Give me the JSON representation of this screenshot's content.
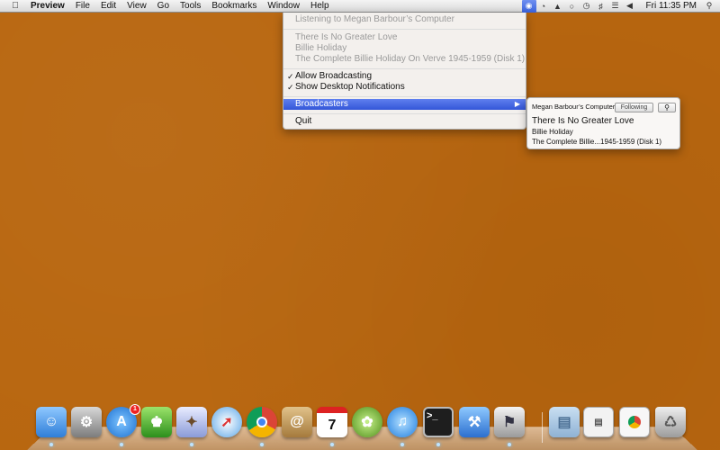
{
  "menubar": {
    "apple_icon": "apple-icon",
    "app_name": "Preview",
    "items": [
      "File",
      "Edit",
      "View",
      "Go",
      "Tools",
      "Bookmarks",
      "Window",
      "Help"
    ],
    "status_icons": [
      "broadcast-icon",
      "clock-sync-icon",
      "shield-icon",
      "circle-icon",
      "time-machine-icon",
      "bluetooth-icon",
      "wifi-icon",
      "volume-icon"
    ],
    "clock": "Fri 11:35 PM",
    "search_icon": "spotlight-search-icon"
  },
  "menu": {
    "header": "Listening to Megan Barbour’s Computer",
    "now_playing": {
      "song": "There Is No Greater Love",
      "artist": "Billie Holiday",
      "album": "The Complete Billie Holiday On Verve 1945-1959 (Disk 1)"
    },
    "allow_broadcasting": "Allow Broadcasting",
    "show_notifications": "Show Desktop Notifications",
    "broadcasters": "Broadcasters",
    "quit": "Quit"
  },
  "submenu": {
    "computer": "Megan Barbour’s Computer",
    "following_button": "Following",
    "song": "There Is No Greater Love",
    "artist": "Billie Holiday",
    "album": "The Complete Billie...1945-1959 (Disk 1)"
  },
  "dock": {
    "items": [
      {
        "name": "finder-icon"
      },
      {
        "name": "system-preferences-icon"
      },
      {
        "name": "app-store-icon",
        "badge": "1"
      },
      {
        "name": "green-app-icon"
      },
      {
        "name": "mail-stamp-icon"
      },
      {
        "name": "safari-icon"
      },
      {
        "name": "chrome-icon"
      },
      {
        "name": "address-book-icon"
      },
      {
        "name": "calendar-icon",
        "label": "7"
      },
      {
        "name": "hops-app-icon"
      },
      {
        "name": "itunes-icon"
      },
      {
        "name": "terminal-icon"
      },
      {
        "name": "xcode-icon"
      },
      {
        "name": "preview-icon"
      },
      {
        "name": "documents-folder-icon"
      },
      {
        "name": "screenshot-stack-icon"
      },
      {
        "name": "chrome-window-stack-icon"
      },
      {
        "name": "trash-icon"
      }
    ]
  }
}
